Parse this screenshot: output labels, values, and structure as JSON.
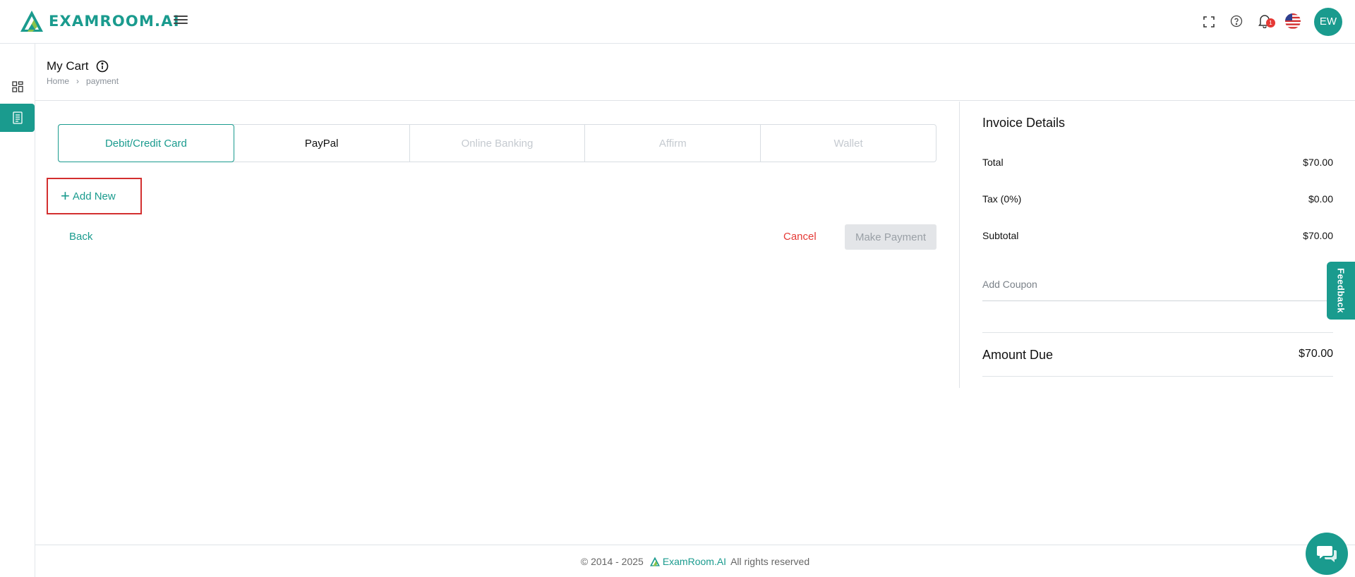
{
  "app": {
    "logo_text": "EXAMROOM.AI",
    "brand_color": "#1a9b8e"
  },
  "topbar": {
    "icons": [
      "fullscreen-icon",
      "help-icon",
      "bell-icon",
      "us-flag-icon"
    ],
    "notification_count": "1",
    "avatar_initials": "EW"
  },
  "sidebar": {
    "items": [
      {
        "icon": "dashboard-grid-icon",
        "active": false
      },
      {
        "icon": "document-list-icon",
        "active": true
      }
    ]
  },
  "page": {
    "title": "My Cart",
    "breadcrumb": [
      "Home",
      "payment"
    ]
  },
  "payment_tabs": [
    {
      "label": "Debit/Credit Card",
      "state": "active"
    },
    {
      "label": "PayPal",
      "state": "normal"
    },
    {
      "label": "Online Banking",
      "state": "disabled"
    },
    {
      "label": "Affirm",
      "state": "disabled"
    },
    {
      "label": "Wallet",
      "state": "disabled"
    }
  ],
  "actions": {
    "add_new": "Add New",
    "back": "Back",
    "cancel": "Cancel",
    "make_payment": "Make Payment"
  },
  "invoice": {
    "title": "Invoice Details",
    "rows": [
      {
        "label": "Total",
        "value": "$70.00"
      },
      {
        "label": "Tax (0%)",
        "value": "$0.00"
      },
      {
        "label": "Subtotal",
        "value": "$70.00"
      }
    ],
    "coupon_placeholder": "Add Coupon",
    "amount_due_label": "Amount Due",
    "amount_due_value": "$70.00"
  },
  "feedback": "Feedback",
  "footer": {
    "copyright": "© 2014 - 2025",
    "brand": "ExamRoom.AI",
    "rights": "All rights reserved"
  }
}
